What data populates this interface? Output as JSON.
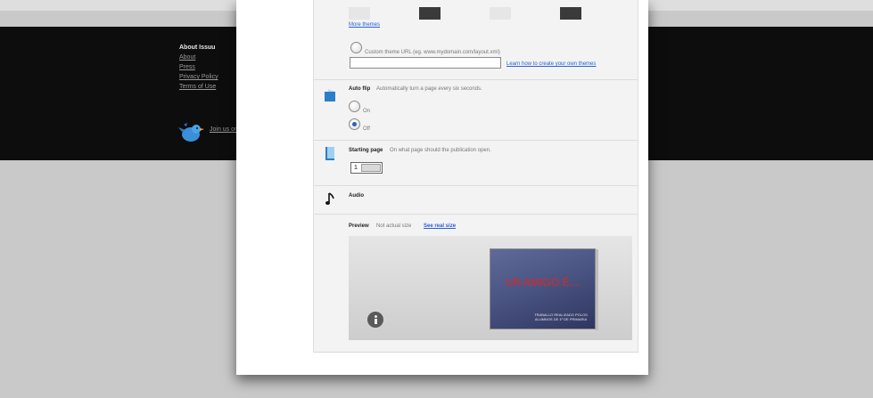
{
  "footer": {
    "heading": "About Issuu",
    "links": [
      "About",
      "Press",
      "Privacy Policy",
      "Terms of Use"
    ],
    "join_text": "Join us on"
  },
  "theme": {
    "more_link": "More themes",
    "custom_label": "Custom theme URL (eg. www.mydomain.com/layout.xml)",
    "custom_value": "",
    "learn_link": "Learn how to create your own themes"
  },
  "auto_flip": {
    "title": "Auto flip",
    "description": "Automatically turn a page every six seconds.",
    "option_on": "On",
    "option_off": "Off",
    "selected": "Off"
  },
  "starting_page": {
    "title": "Starting page",
    "description": "On what page should the publication open.",
    "value": "1"
  },
  "audio": {
    "title": "Audio"
  },
  "preview": {
    "title": "Preview",
    "description": "Not actual size",
    "link": "See real size",
    "book_title": "UN AMIGO É....",
    "book_subtitle": "TRABALLO REALIZADO POLOS ALUMNOS DE 1º DE PRIMARIA"
  },
  "colors": {
    "page_bg": "#c9c9c9",
    "footer_bg": "#0d0d0d",
    "link_blue": "#2a5fd6",
    "book_title_red": "#e0261e",
    "book_bg": "#4b5583"
  }
}
